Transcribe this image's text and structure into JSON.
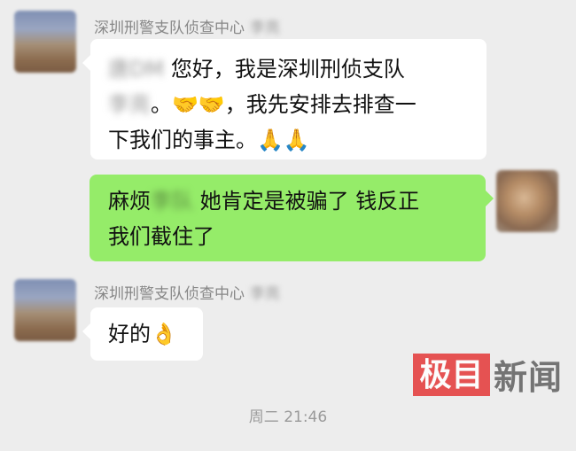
{
  "messages": [
    {
      "side": "left",
      "sender": {
        "name": "深圳刑警支队侦查中心",
        "name_suffix_redacted": "李亮"
      },
      "lines": [
        {
          "redacted": "唐DM",
          "text": " 您好，我是深圳刑侦支队"
        },
        {
          "redacted": "李亮",
          "text": "。🤝🤝，我先安排去排查一"
        },
        {
          "redacted": "",
          "text": "下我们的事主。🙏🙏"
        }
      ]
    },
    {
      "side": "right",
      "lines": [
        {
          "text_before": "麻烦",
          "redacted": "李队",
          "text": " 她肯定是被骗了 钱反正"
        },
        {
          "redacted": "",
          "text": "我们截住了"
        }
      ]
    },
    {
      "side": "left",
      "sender": {
        "name": "深圳刑警支队侦查中心",
        "name_suffix_redacted": "李亮"
      },
      "lines": [
        {
          "redacted": "",
          "text": "好的👌"
        }
      ]
    }
  ],
  "timestamp": "周二 21:46",
  "watermark": {
    "box_text": "极目",
    "text": "新闻",
    "box_color": "#e53d3d"
  },
  "colors": {
    "background": "#ededed",
    "incoming_bubble": "#ffffff",
    "outgoing_bubble": "#95ec69"
  }
}
